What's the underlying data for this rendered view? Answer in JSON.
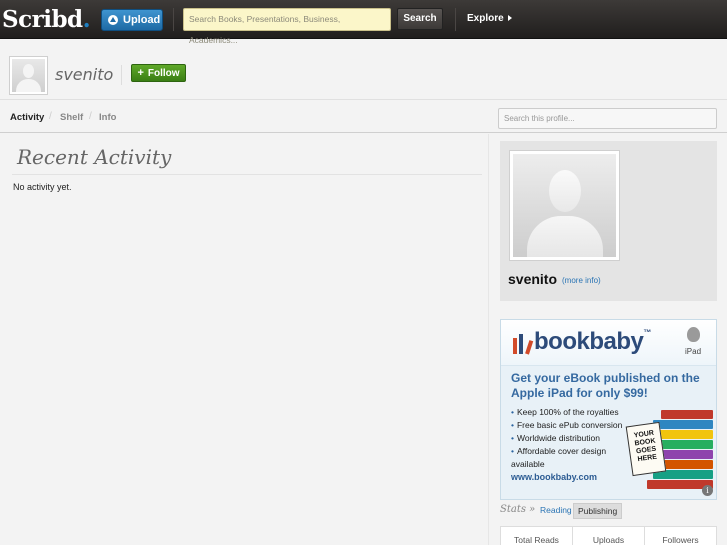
{
  "topbar": {
    "logo_text": "Scribd",
    "logo_dot": ".",
    "upload_label": "Upload",
    "search_placeholder": "Search Books, Presentations, Business, Academics...",
    "search_button": "Search",
    "explore_label": "Explore"
  },
  "profile": {
    "username": "svenito",
    "follow_label": "Follow"
  },
  "tabs": [
    {
      "label": "Activity",
      "active": true
    },
    {
      "label": "Shelf",
      "active": false
    },
    {
      "label": "Info",
      "active": false
    }
  ],
  "tab_divider": "/",
  "profile_search_placeholder": "Search this profile...",
  "main": {
    "title": "Recent Activity",
    "empty_message": "No activity yet."
  },
  "sidebar": {
    "name": "svenito",
    "more_info": "(more info)"
  },
  "ad": {
    "logo": "bookbaby",
    "tm": "™",
    "platform_label": "iPad",
    "headline": "Get your eBook published on the Apple iPad for only $99!",
    "bullets": [
      "Keep 100% of the royalties",
      "Free basic ePub conversion",
      "Worldwide distribution",
      "Affordable cover design available"
    ],
    "url": "www.bookbaby.com",
    "book_cover_text": "YOUR BOOK GOES HERE",
    "info_icon": "i"
  },
  "stats": {
    "label": "Stats »",
    "tabs": [
      "Reading",
      "Publishing"
    ],
    "columns": [
      "Total Reads",
      "Uploads",
      "Followers"
    ]
  },
  "colors": {
    "brand_blue": "#1e7fc1",
    "follow_green": "#4a9320",
    "link_blue": "#2a74b4"
  }
}
